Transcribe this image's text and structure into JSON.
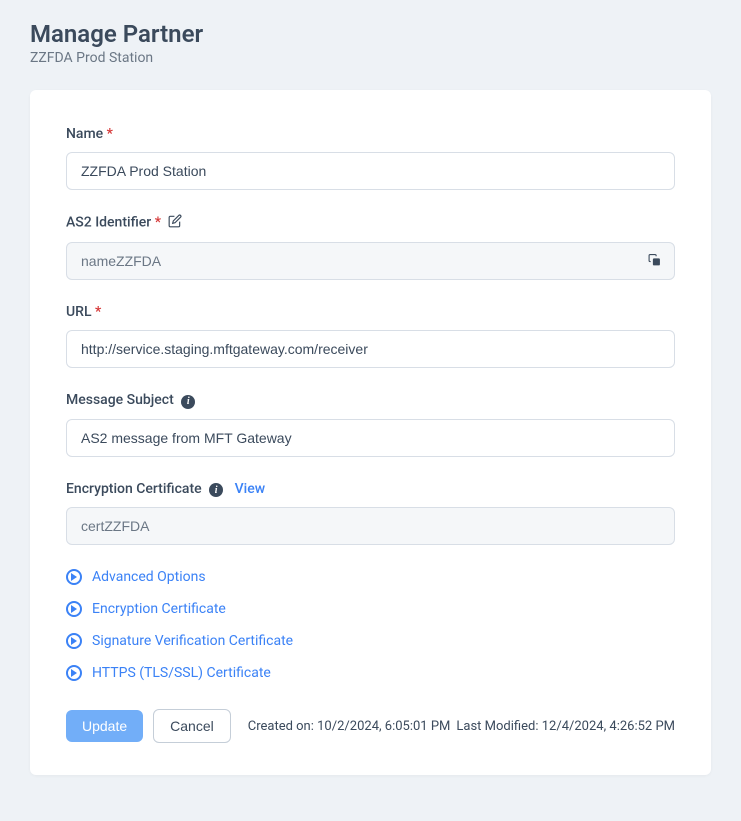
{
  "header": {
    "title": "Manage Partner",
    "subtitle": "ZZFDA Prod Station"
  },
  "form": {
    "name": {
      "label": "Name",
      "required": "*",
      "value": "ZZFDA Prod Station"
    },
    "as2_identifier": {
      "label": "AS2 Identifier",
      "required": "*",
      "value": "nameZZFDA"
    },
    "url": {
      "label": "URL",
      "required": "*",
      "value": "http://service.staging.mftgateway.com/receiver"
    },
    "message_subject": {
      "label": "Message Subject",
      "value": "AS2 message from MFT Gateway"
    },
    "encryption_certificate": {
      "label": "Encryption Certificate",
      "view_label": "View",
      "value": "certZZFDA"
    }
  },
  "sections": {
    "advanced_options": "Advanced Options",
    "encryption_certificate": "Encryption Certificate",
    "signature_verification": "Signature Verification Certificate",
    "https_certificate": "HTTPS (TLS/SSL) Certificate"
  },
  "actions": {
    "update": "Update",
    "cancel": "Cancel"
  },
  "timestamps": {
    "created_label": "Created on:",
    "created_value": "10/2/2024, 6:05:01 PM",
    "modified_label": "Last Modified:",
    "modified_value": "12/4/2024, 4:26:52 PM"
  }
}
